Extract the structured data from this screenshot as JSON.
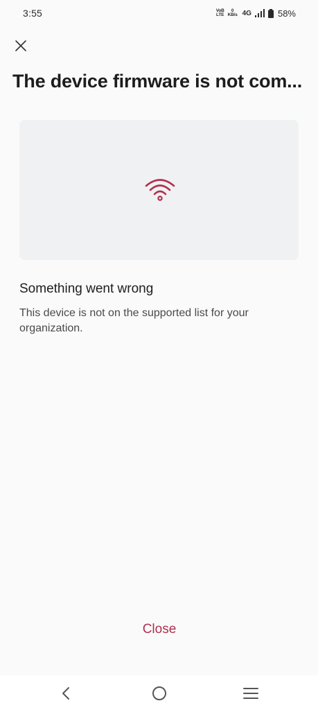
{
  "status_bar": {
    "time": "3:55",
    "volte_top": "VoB",
    "volte_bottom": "LTE",
    "data_rate_value": "0",
    "data_rate_unit": "KB/s",
    "network_type": "4G",
    "battery_percent": "58%"
  },
  "dialog": {
    "title": "The device firmware is not com...",
    "error_heading": "Something went wrong",
    "error_message": "This device is not on the supported list for your organization.",
    "close_label": "Close"
  },
  "icons": {
    "close": "close-icon",
    "illustration": "wifi-icon",
    "nav_back": "back-icon",
    "nav_home": "home-icon",
    "nav_menu": "menu-icon",
    "signal": "signal-icon",
    "battery": "battery-icon"
  },
  "colors": {
    "accent": "#b0304e",
    "background": "#fafafa",
    "card": "#f0f1f2",
    "text_primary": "#1d1d1f",
    "text_secondary": "#4a4a4a"
  }
}
